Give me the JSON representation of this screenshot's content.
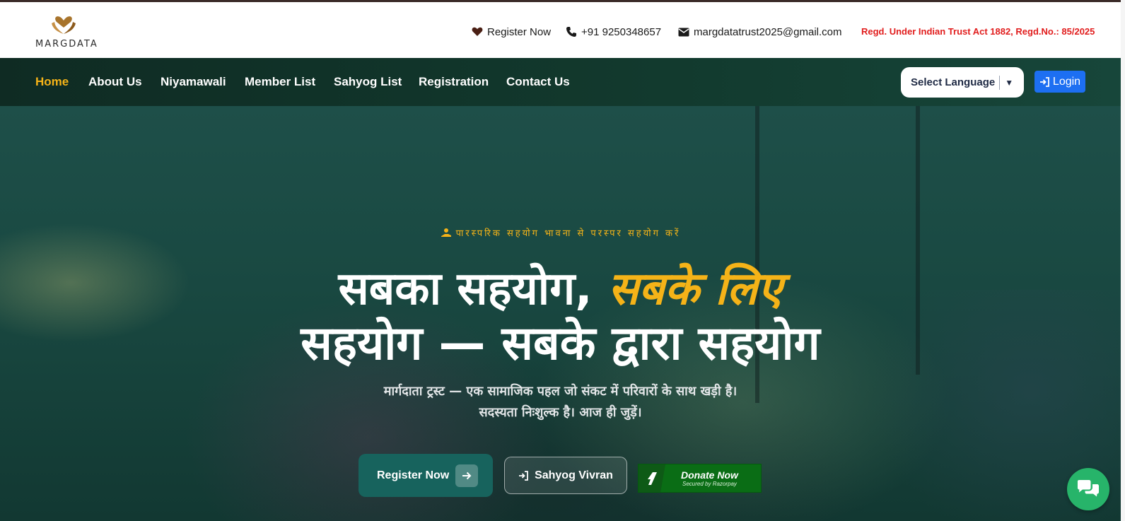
{
  "brand": {
    "logo_text": "MARGDATA"
  },
  "contacts": {
    "register_label": "Register Now",
    "register_icon": "heart-icon",
    "phone": "+91 9250348657",
    "phone_icon": "phone-icon",
    "email": "margdatatrust2025@gmail.com",
    "email_icon": "envelope-icon",
    "regd_text": "Regd. Under Indian Trust Act 1882, Regd.No.: 85/2025"
  },
  "nav": {
    "items": [
      {
        "label": "Home",
        "active": true
      },
      {
        "label": "About Us"
      },
      {
        "label": "Niyamawali"
      },
      {
        "label": "Member List"
      },
      {
        "label": "Sahyog List"
      },
      {
        "label": "Registration"
      },
      {
        "label": "Contact Us"
      }
    ],
    "language_label": "Select Language",
    "login_label": "Login"
  },
  "hero": {
    "tagline": "पारस्परिक सहयोग भावना से परस्पर सहयोग करें",
    "headline_part1": "सबका सहयोग, ",
    "headline_highlight": "सबके लिए",
    "headline_line2": "सहयोग — सबके द्वारा सहयोग",
    "subtitle_line1": "मार्गदाता ट्रस्ट — एक सामाजिक पहल जो संकट में परिवारों के साथ खड़ी है।",
    "subtitle_line2": "सदस्यता निःशुल्क है। आज ही जुड़ें।",
    "register_button": "Register Now",
    "vivran_button": "Sahyog Vivran",
    "donate_label": "Donate Now",
    "donate_sub": "Secured by Razorpay"
  },
  "colors": {
    "accent": "#f5b318",
    "nav_bg": "#123a2e",
    "login_blue": "#1d6ff2",
    "regd_red": "#e11d1d",
    "chat_green": "#27b46a"
  }
}
